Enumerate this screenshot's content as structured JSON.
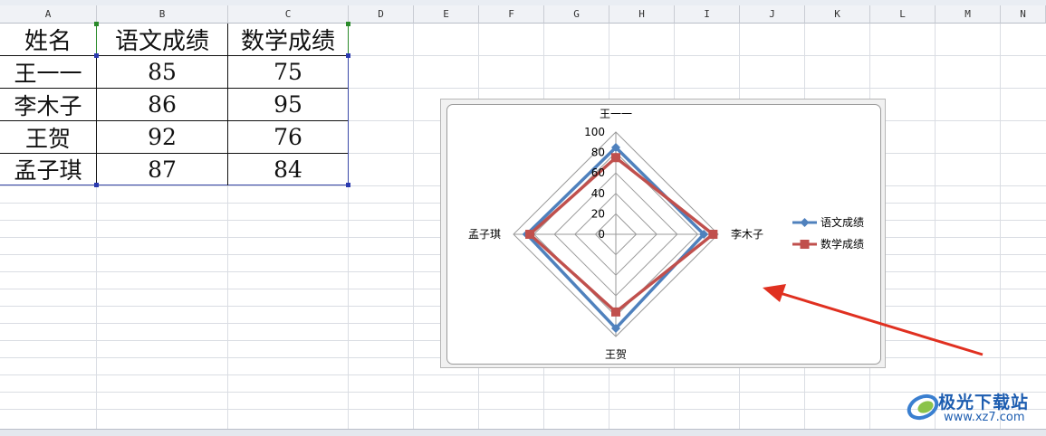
{
  "sheet": {
    "columns": [
      "A",
      "B",
      "C",
      "D",
      "E",
      "F",
      "G",
      "H",
      "I",
      "J",
      "K",
      "L",
      "M",
      "N"
    ],
    "table": {
      "headers": [
        "姓名",
        "语文成绩",
        "数学成绩"
      ],
      "rows": [
        [
          "王一一",
          "85",
          "75"
        ],
        [
          "李木子",
          "86",
          "95"
        ],
        [
          "王贺",
          "92",
          "76"
        ],
        [
          "孟子琪",
          "87",
          "84"
        ]
      ]
    }
  },
  "chart_data": {
    "type": "radar",
    "categories": [
      "王一一",
      "李木子",
      "王贺",
      "孟子琪"
    ],
    "series": [
      {
        "name": "语文成绩",
        "values": [
          85,
          86,
          92,
          87
        ],
        "color": "#4f81bd",
        "marker": "diamond"
      },
      {
        "name": "数学成绩",
        "values": [
          75,
          95,
          76,
          84
        ],
        "color": "#c0504d",
        "marker": "square"
      }
    ],
    "rlim": [
      0,
      100
    ],
    "ticks": [
      0,
      20,
      40,
      60,
      80,
      100
    ],
    "grid": true,
    "legend": "right"
  },
  "watermark": {
    "text": "极光下载站",
    "url": "www.xz7.com",
    "brand_color": "#1d5db0"
  },
  "annotation": {
    "arrow_color": "#e03020"
  }
}
